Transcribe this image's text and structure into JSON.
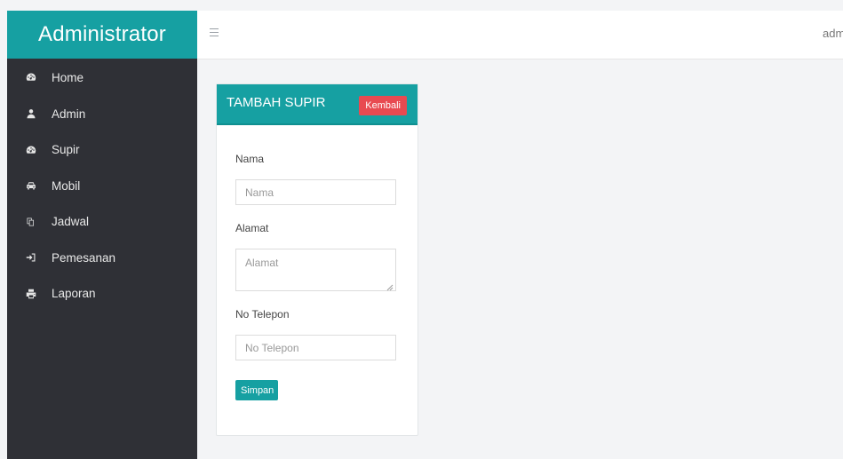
{
  "sidebar": {
    "brand": "Administrator",
    "items": [
      {
        "label": "Home",
        "icon": "dashboard-icon"
      },
      {
        "label": "Admin",
        "icon": "user-icon"
      },
      {
        "label": "Supir",
        "icon": "dashboard-icon"
      },
      {
        "label": "Mobil",
        "icon": "car-icon"
      },
      {
        "label": "Jadwal",
        "icon": "copy-icon"
      },
      {
        "label": "Pemesanan",
        "icon": "sign-in-icon"
      },
      {
        "label": "Laporan",
        "icon": "print-icon"
      }
    ]
  },
  "topbar": {
    "user": "admin"
  },
  "form": {
    "title": "TAMBAH SUPIR",
    "back_label": "Kembali",
    "fields": {
      "nama": {
        "label": "Nama",
        "placeholder": "Nama"
      },
      "alamat": {
        "label": "Alamat",
        "placeholder": "Alamat"
      },
      "telepon": {
        "label": "No Telepon",
        "placeholder": "No Telepon"
      }
    },
    "save_label": "Simpan"
  },
  "colors": {
    "accent": "#16a0a2",
    "sidebar_bg": "#2f3036",
    "danger": "#e84a51"
  }
}
